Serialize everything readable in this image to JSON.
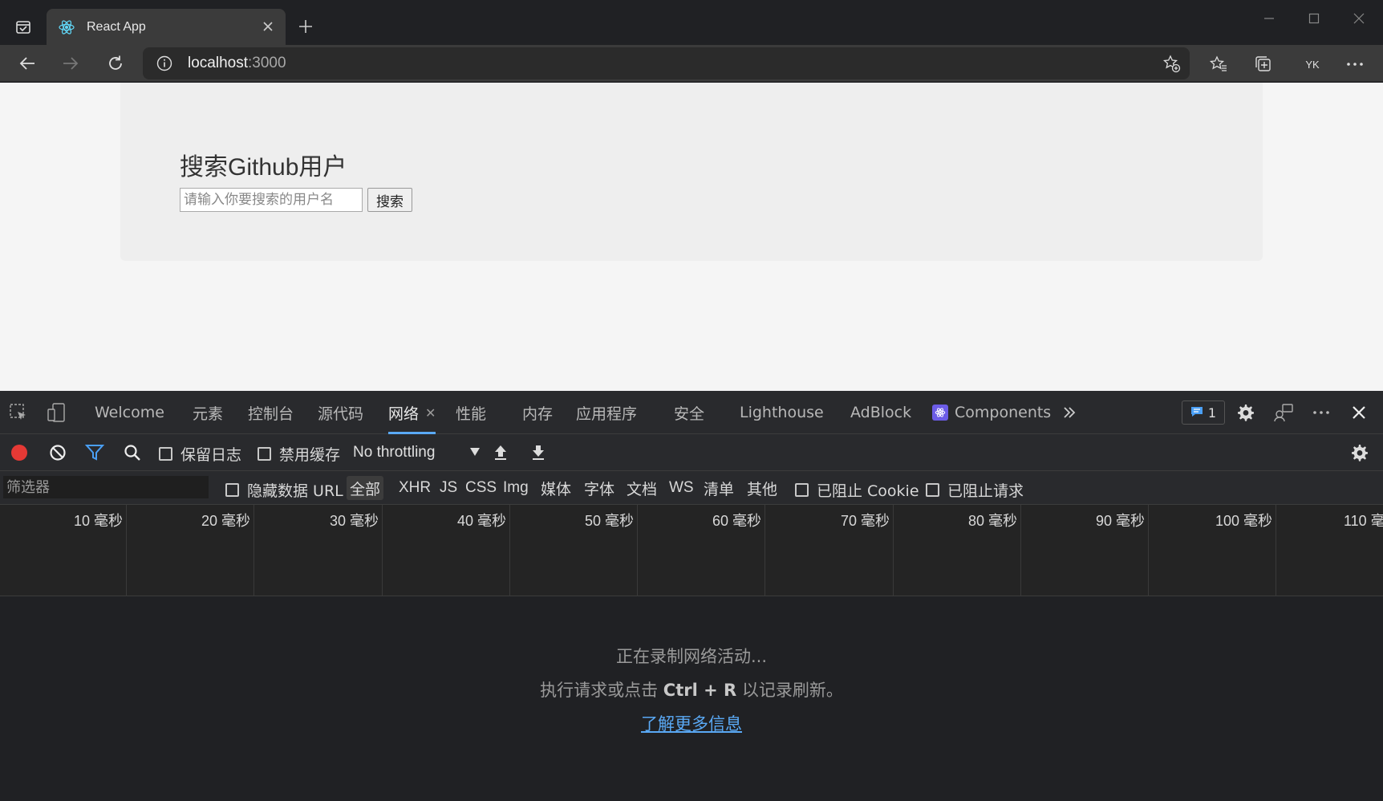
{
  "browser": {
    "tab_title": "React App",
    "url_host": "localhost",
    "url_port": ":3000",
    "profile_label": "YK"
  },
  "page": {
    "heading": "搜索Github用户",
    "search_placeholder": "请输入你要搜索的用户名",
    "search_button": "搜索"
  },
  "devtools": {
    "tabs": [
      "Welcome",
      "元素",
      "控制台",
      "源代码",
      "网络",
      "性能",
      "内存",
      "应用程序",
      "安全",
      "Lighthouse",
      "AdBlock",
      "Components"
    ],
    "active_tab": "网络",
    "issues_count": "1",
    "network_toolbar": {
      "preserve_log": "保留日志",
      "disable_cache": "禁用缓存",
      "throttling": "No throttling"
    },
    "filter": {
      "placeholder": "筛选器",
      "hide_data_urls": "隐藏数据 URL",
      "types": [
        "全部",
        "XHR",
        "JS",
        "CSS",
        "Img",
        "媒体",
        "字体",
        "文档",
        "WS",
        "清单",
        "其他"
      ],
      "active_type": "全部",
      "blocked_cookies": "已阻止 Cookie",
      "blocked_requests": "已阻止请求"
    },
    "timeline_ticks": [
      "10 毫秒",
      "20 毫秒",
      "30 毫秒",
      "40 毫秒",
      "50 毫秒",
      "60 毫秒",
      "70 毫秒",
      "80 毫秒",
      "90 毫秒",
      "100 毫秒",
      "110 毫"
    ],
    "empty_state": {
      "line1": "正在录制网络活动...",
      "line2_pre": "执行请求或点击 ",
      "line2_key": "Ctrl + R",
      "line2_post": " 以记录刷新。",
      "link": "了解更多信息"
    }
  },
  "colors": {
    "record": "#e53935",
    "filter_active": "#4a9ff5",
    "link": "#5aa9f5",
    "react_blue": "#61dafb"
  }
}
